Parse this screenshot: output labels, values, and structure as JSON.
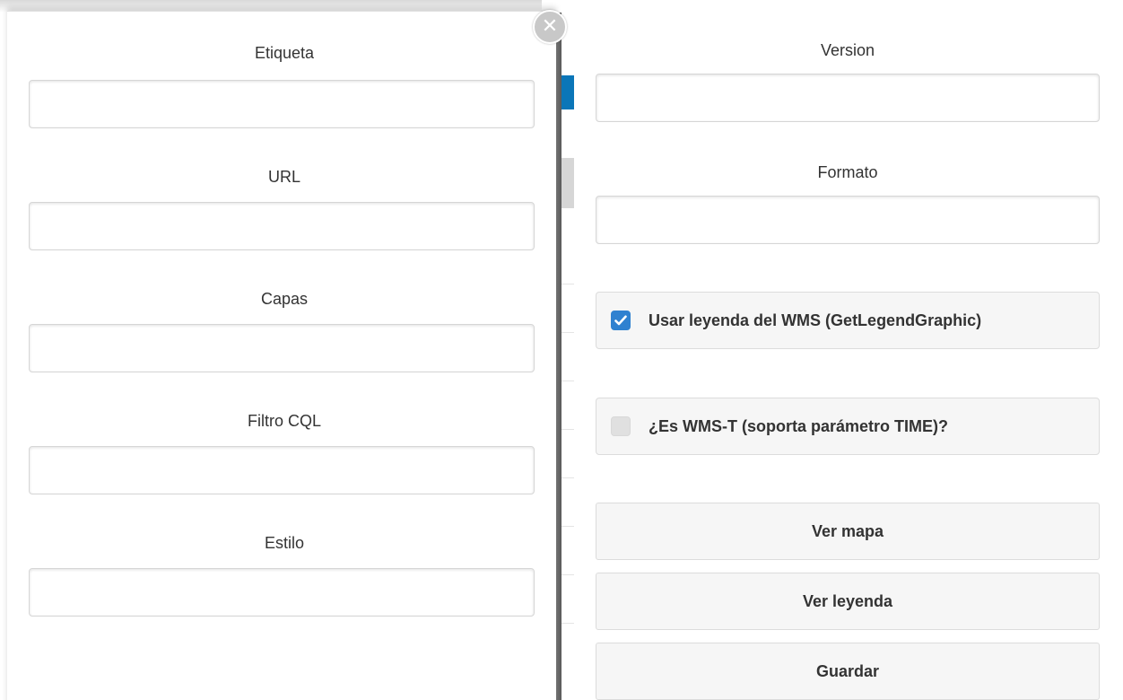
{
  "left_form": {
    "close_icon": "close-circle-icon",
    "fields": [
      {
        "label": "Etiqueta",
        "value": "",
        "placeholder": ""
      },
      {
        "label": "URL",
        "value": "",
        "placeholder": ""
      },
      {
        "label": "Capas",
        "value": "",
        "placeholder": ""
      },
      {
        "label": "Filtro CQL",
        "value": "",
        "placeholder": ""
      },
      {
        "label": "Estilo",
        "value": "",
        "placeholder": ""
      }
    ]
  },
  "right_form": {
    "fields": [
      {
        "label": "Version",
        "value": "",
        "placeholder": ""
      },
      {
        "label": "Formato",
        "value": "",
        "placeholder": ""
      }
    ],
    "checkboxes": [
      {
        "label": "Usar leyenda del WMS (GetLegendGraphic)",
        "checked": true
      },
      {
        "label": "¿Es WMS-T (soporta parámetro TIME)?",
        "checked": false
      }
    ],
    "buttons": {
      "view_map": "Ver mapa",
      "view_legend": "Ver leyenda",
      "save": "Guardar"
    }
  },
  "colors": {
    "checkbox_checked": "#2f81d0",
    "background_blue": "#0b76b8",
    "button_bg": "#f6f6f6"
  }
}
